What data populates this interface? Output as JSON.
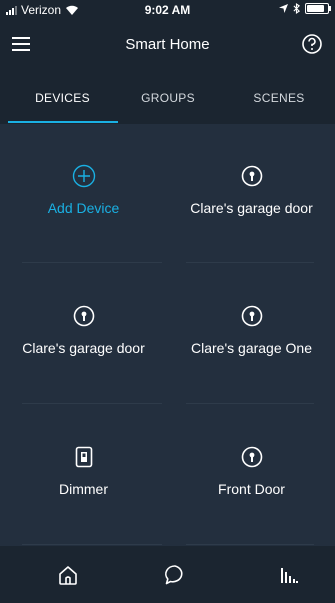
{
  "status_bar": {
    "carrier": "Verizon",
    "time": "9:02 AM",
    "battery_fraction": 0.95
  },
  "header": {
    "title": "Smart Home",
    "menu_icon": "hamburger-menu-icon",
    "help_icon": "help-circle-icon"
  },
  "tabs": [
    {
      "label": "DEVICES",
      "active": true
    },
    {
      "label": "GROUPS",
      "active": false
    },
    {
      "label": "SCENES",
      "active": false
    }
  ],
  "tiles": [
    {
      "label": "Add Device",
      "icon": "plus-circle-icon"
    },
    {
      "label": "Clare's garage door",
      "icon": "info-circle-icon"
    },
    {
      "label": "Clare's garage door",
      "icon": "info-circle-icon"
    },
    {
      "label": "Clare's garage One",
      "icon": "info-circle-icon"
    },
    {
      "label": "Dimmer",
      "icon": "light-switch-icon"
    },
    {
      "label": "Front Door",
      "icon": "info-circle-icon"
    }
  ],
  "bottom_nav": [
    {
      "icon": "home-icon"
    },
    {
      "icon": "chat-bubble-icon"
    },
    {
      "icon": "equalizer-icon"
    }
  ],
  "colors": {
    "background": "#232f3e",
    "bar": "#1b2530",
    "accent": "#1ab0e3"
  }
}
